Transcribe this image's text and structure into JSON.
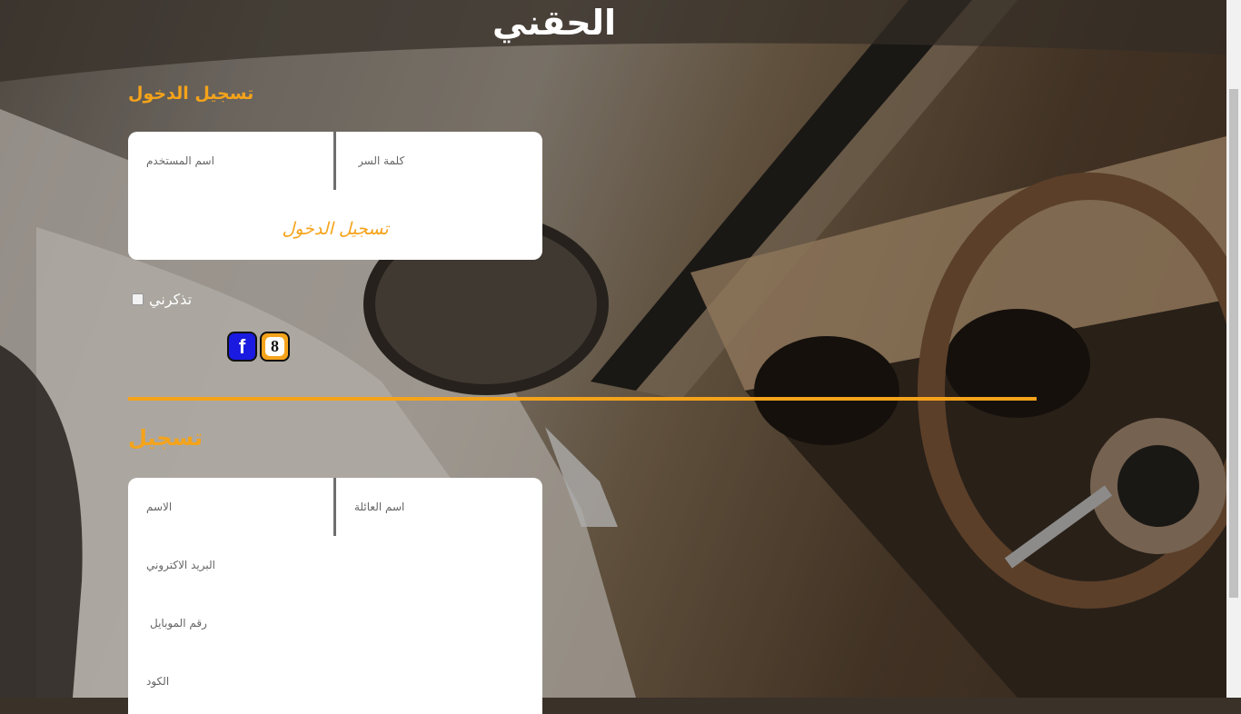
{
  "header": {
    "title": "الحقني"
  },
  "login": {
    "heading": "تسجيل الدخول",
    "username_placeholder": "اسم المستخدم",
    "password_placeholder": "كلمة السر",
    "submit_label": "تسجيل الدخول",
    "remember_label": "تذكرني",
    "remember_checked": false
  },
  "social": {
    "facebook_icon": "facebook-icon",
    "google_icon": "google-icon",
    "facebook_glyph": "f",
    "google_glyph": "8"
  },
  "register": {
    "heading": "تسجيل",
    "first_name_placeholder": "الاسم",
    "last_name_placeholder": "اسم العائلة",
    "email_placeholder": "البريد الاكتروني",
    "mobile_placeholder": "رقم الموبايل",
    "code_placeholder": "الكود"
  },
  "colors": {
    "accent": "#f5a31a",
    "facebook": "#1a1ae0",
    "card": "#ffffff"
  }
}
